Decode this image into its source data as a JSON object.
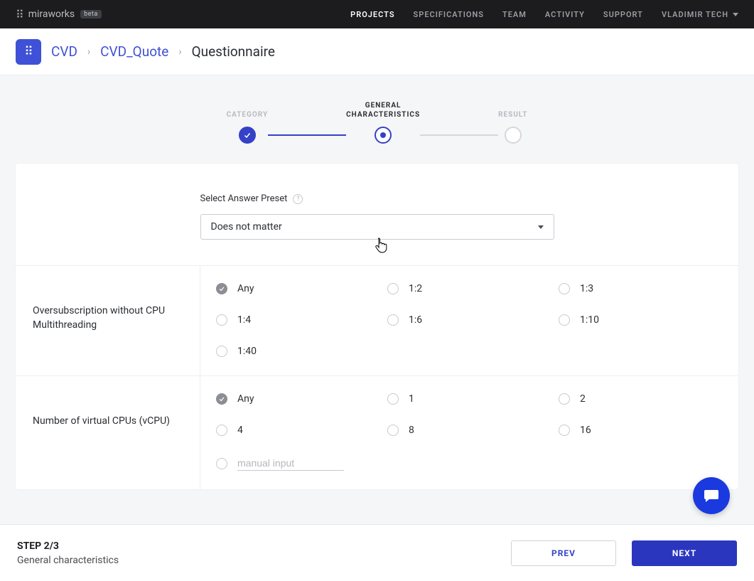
{
  "brand": {
    "name": "miraworks",
    "badge": "beta"
  },
  "nav": {
    "items": [
      "PROJECTS",
      "SPECIFICATIONS",
      "TEAM",
      "ACTIVITY",
      "SUPPORT"
    ],
    "active_index": 0,
    "user": "VLADIMIR TECH"
  },
  "breadcrumb": {
    "items": [
      "CVD",
      "CVD_Quote"
    ],
    "current": "Questionnaire"
  },
  "stepper": {
    "steps": [
      "CATEGORY",
      "GENERAL CHARACTERISTICS",
      "RESULT"
    ],
    "done_index": 0,
    "active_index": 1
  },
  "preset": {
    "label": "Select Answer Preset",
    "value": "Does not matter"
  },
  "questions": [
    {
      "label": "Oversubscription without CPU Multithreading",
      "selected": "Any",
      "options": [
        "Any",
        "1:2",
        "1:3",
        "1:4",
        "1:6",
        "1:10",
        "1:40"
      ]
    },
    {
      "label": "Number of virtual CPUs (vCPU)",
      "selected": "Any",
      "options": [
        "Any",
        "1",
        "2",
        "4",
        "8",
        "16"
      ],
      "manual_placeholder": "manual input"
    }
  ],
  "footer": {
    "step_count": "STEP 2/3",
    "step_name": "General characteristics",
    "prev": "PREV",
    "next": "NEXT"
  }
}
